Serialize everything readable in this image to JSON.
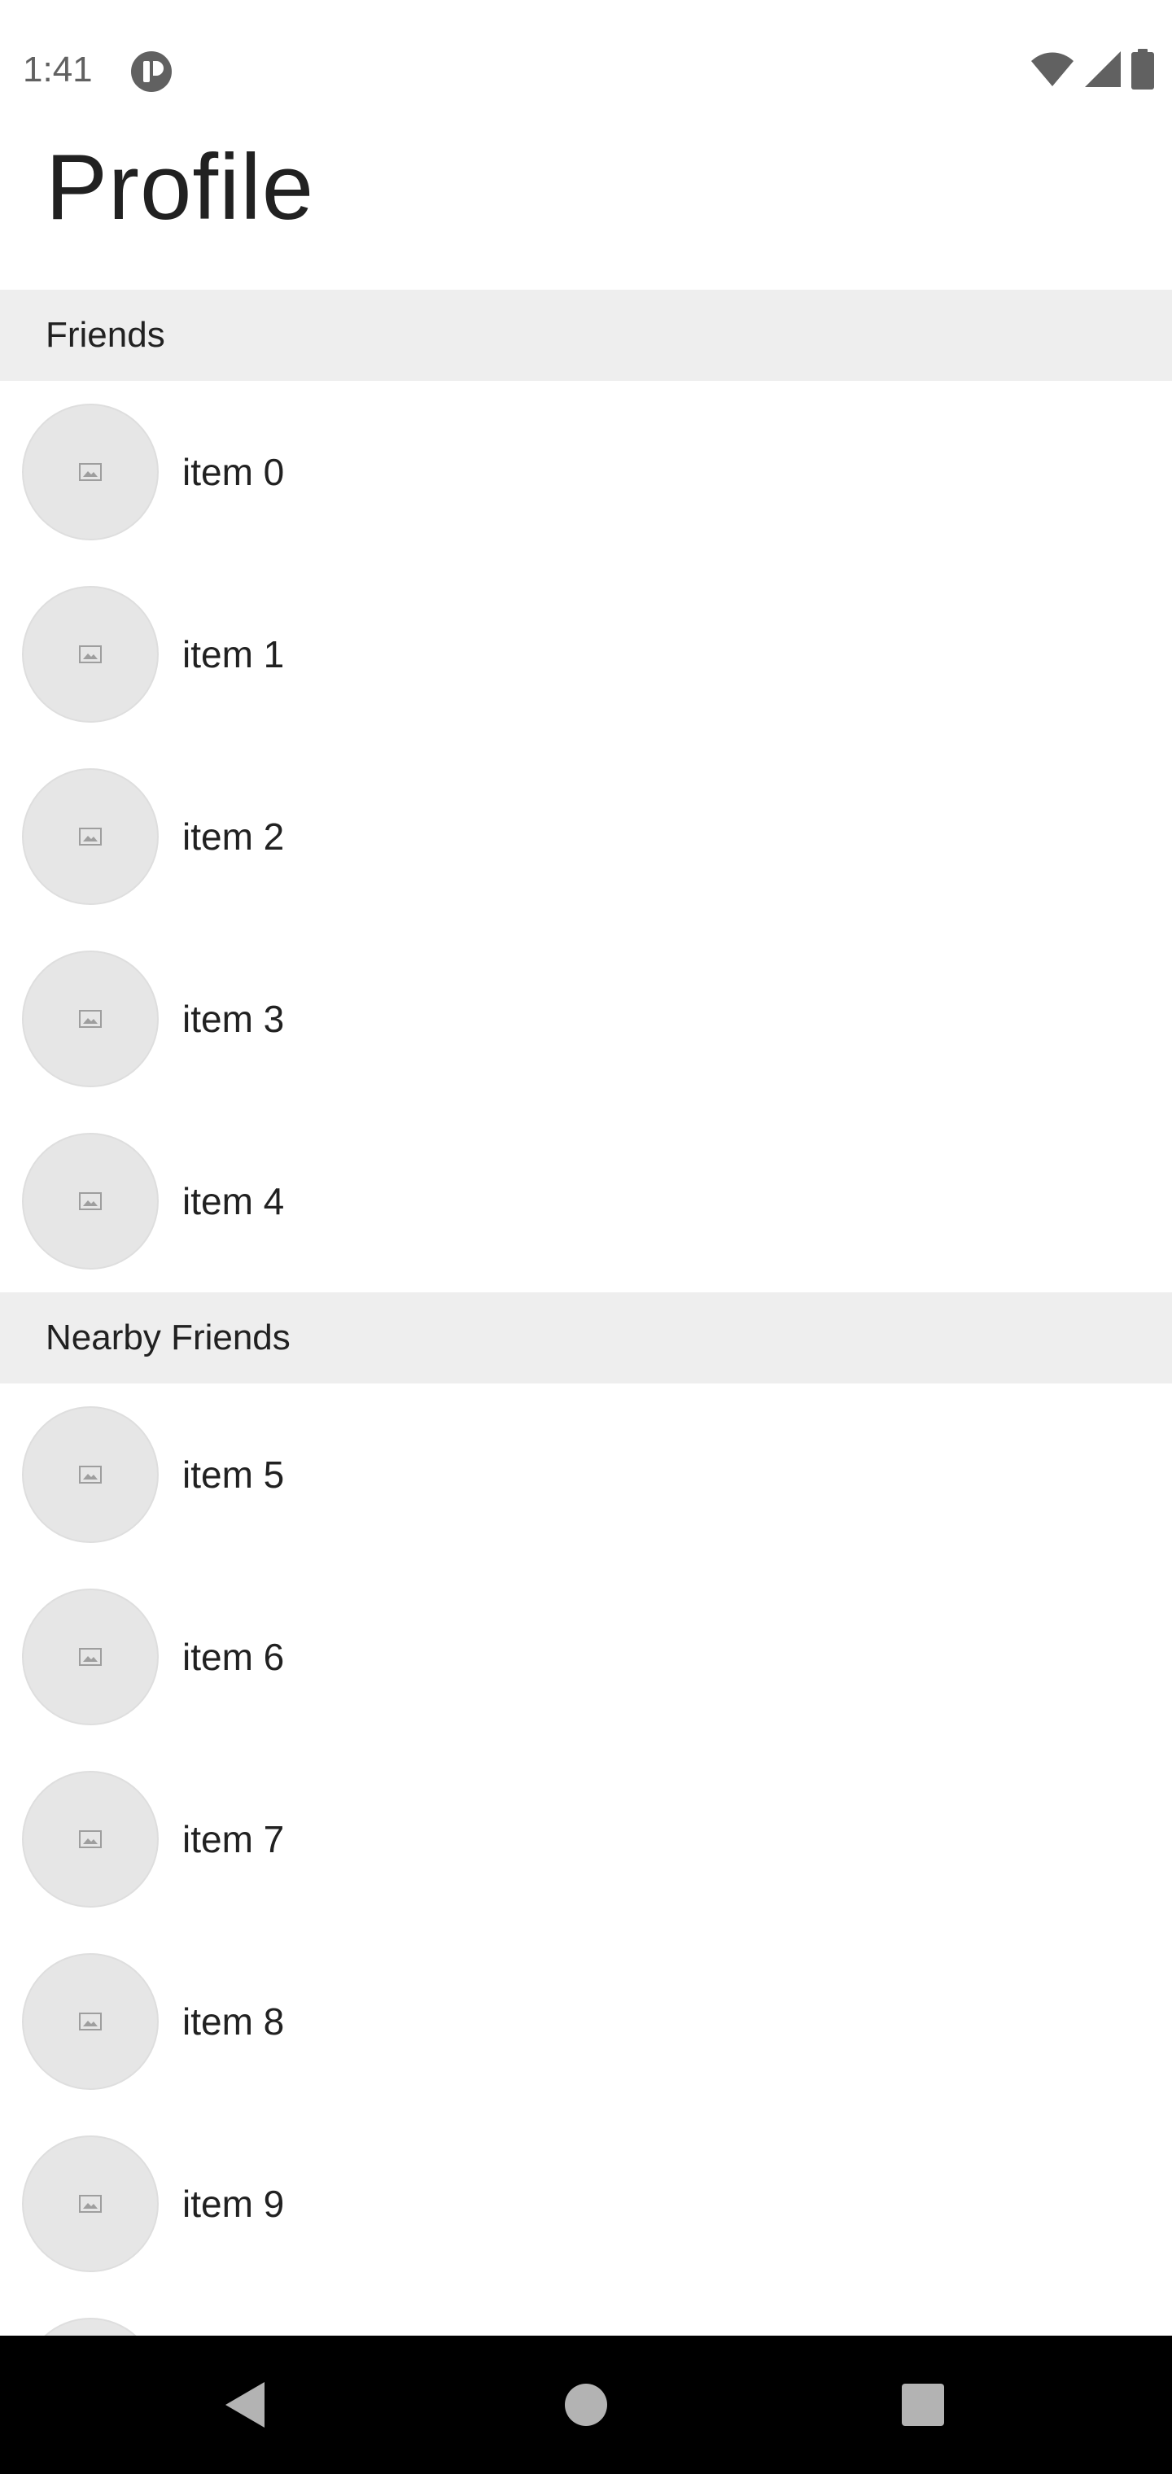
{
  "status_bar": {
    "time": "1:41",
    "icons": [
      "app-notification-icon",
      "wifi-icon",
      "cell-signal-icon",
      "battery-icon"
    ]
  },
  "header": {
    "title": "Profile"
  },
  "sections": [
    {
      "title": "Friends",
      "items": [
        "item 0",
        "item 1",
        "item 2",
        "item 3",
        "item 4"
      ]
    },
    {
      "title": "Nearby Friends",
      "items": [
        "item 5",
        "item 6",
        "item 7",
        "item 8",
        "item 9",
        ""
      ]
    }
  ],
  "nav_bar": {
    "buttons": [
      "back-icon",
      "home-icon",
      "recents-icon"
    ]
  },
  "colors": {
    "section_bg": "#eeeeee",
    "avatar_bg": "#e6e6e6",
    "nav_bg": "#000000"
  }
}
